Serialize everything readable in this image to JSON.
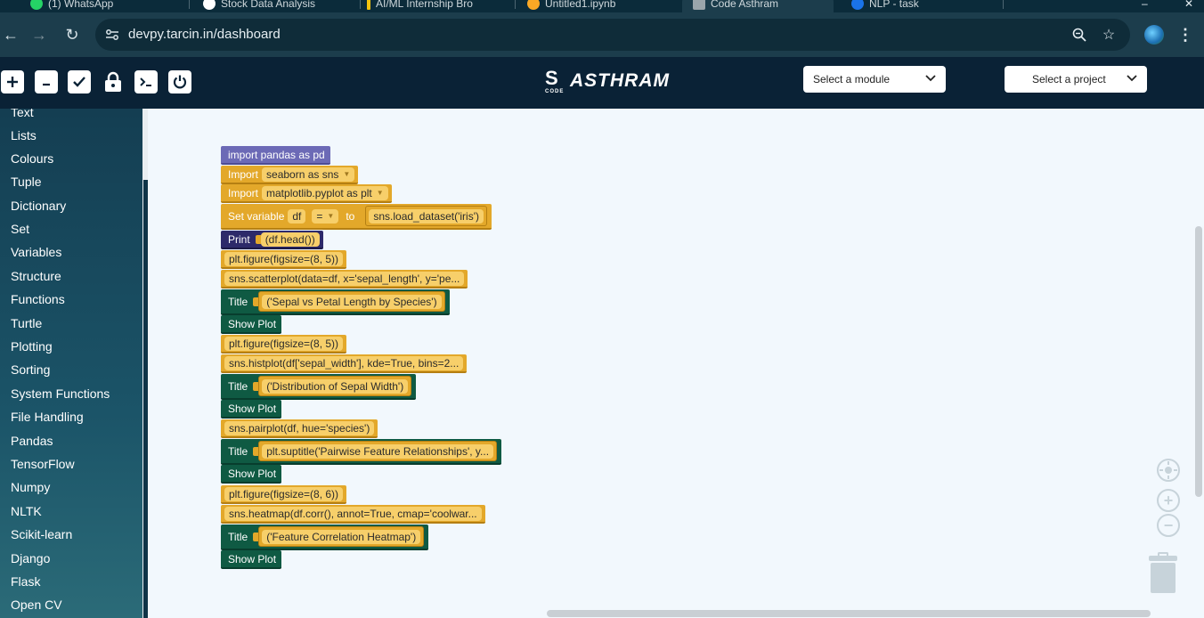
{
  "browser": {
    "tabs": [
      {
        "label": "(1) WhatsApp",
        "color": "#25d366"
      },
      {
        "label": "Stock Data Analysis",
        "color": "#ffffff"
      },
      {
        "label": "AI/ML Internship Bro",
        "color": "#f4c20d"
      },
      {
        "label": "Untitled1.ipynb",
        "color": "#f9a825"
      },
      {
        "label": "Code Asthram",
        "color": "#9aa5ab"
      },
      {
        "label": "NLP - task",
        "color": "#1a73e8"
      },
      {
        "label": "",
        "color": "#9aa5ab"
      }
    ],
    "url": "devpy.tarcin.in/dashboard",
    "icons": {
      "back": "arrow-left-icon",
      "forward": "arrow-right-icon",
      "reload": "reload-icon",
      "site_info": "tune-icon",
      "zoom": "zoom-icon",
      "bookmark": "star-icon",
      "profile": "profile-avatar",
      "menu": "kebab-menu-icon"
    }
  },
  "header": {
    "tools": [
      {
        "name": "new-file",
        "icon": "plus-icon"
      },
      {
        "name": "minimize",
        "icon": "file-minus-icon"
      },
      {
        "name": "check",
        "icon": "check-icon"
      },
      {
        "name": "lock",
        "icon": "lock-icon"
      },
      {
        "name": "terminal",
        "icon": "terminal-icon"
      },
      {
        "name": "power",
        "icon": "power-icon"
      }
    ],
    "logo_text": "ASTHRAM",
    "logo_sub": "CODE",
    "module_select": "Select a module",
    "project_select": "Select a project"
  },
  "sidebar": {
    "categories": [
      "Text",
      "Lists",
      "Colours",
      "Tuple",
      "Dictionary",
      "Set",
      "Variables",
      "Structure",
      "Functions",
      "Turtle",
      "Plotting",
      "Sorting",
      "System Functions",
      "File Handling",
      "Pandas",
      "TensorFlow",
      "Numpy",
      "NLTK",
      "Scikit-learn",
      "Django",
      "Flask",
      "Open CV"
    ]
  },
  "workspace": {
    "blocks": {
      "import_pandas": "import pandas as pd",
      "import_kw": "Import",
      "import1_value": "seaborn as sns",
      "import2_value": "matplotlib.pyplot as plt",
      "setvar_kw": "Set variable",
      "setvar_name": "df",
      "setvar_op": "=",
      "setvar_to": "to",
      "setvar_value": "sns.load_dataset('iris')",
      "print_kw": "Print",
      "print_value": "(df.head())",
      "figure1": "plt.figure(figsize=(8, 5))",
      "scatter": "sns.scatterplot(data=df, x='sepal_length', y='pe...",
      "title_kw": "Title",
      "title1": "('Sepal vs Petal Length by Species')",
      "show_plot": "Show Plot",
      "figure2": "plt.figure(figsize=(8, 5))",
      "hist": "sns.histplot(df['sepal_width'], kde=True, bins=2...",
      "title2": "('Distribution of Sepal Width')",
      "pairplot": "sns.pairplot(df, hue='species')",
      "title3": "plt.suptitle('Pairwise Feature Relationships', y...",
      "figure3": "plt.figure(figsize=(8, 6))",
      "heatmap": "sns.heatmap(df.corr(), annot=True, cmap='coolwar...",
      "title4": "('Feature Correlation Heatmap')"
    },
    "controls": {
      "recenter": "target-icon",
      "zoom_in": "zoom-in-icon",
      "zoom_out": "zoom-out-icon",
      "trash": "trash-icon"
    }
  }
}
